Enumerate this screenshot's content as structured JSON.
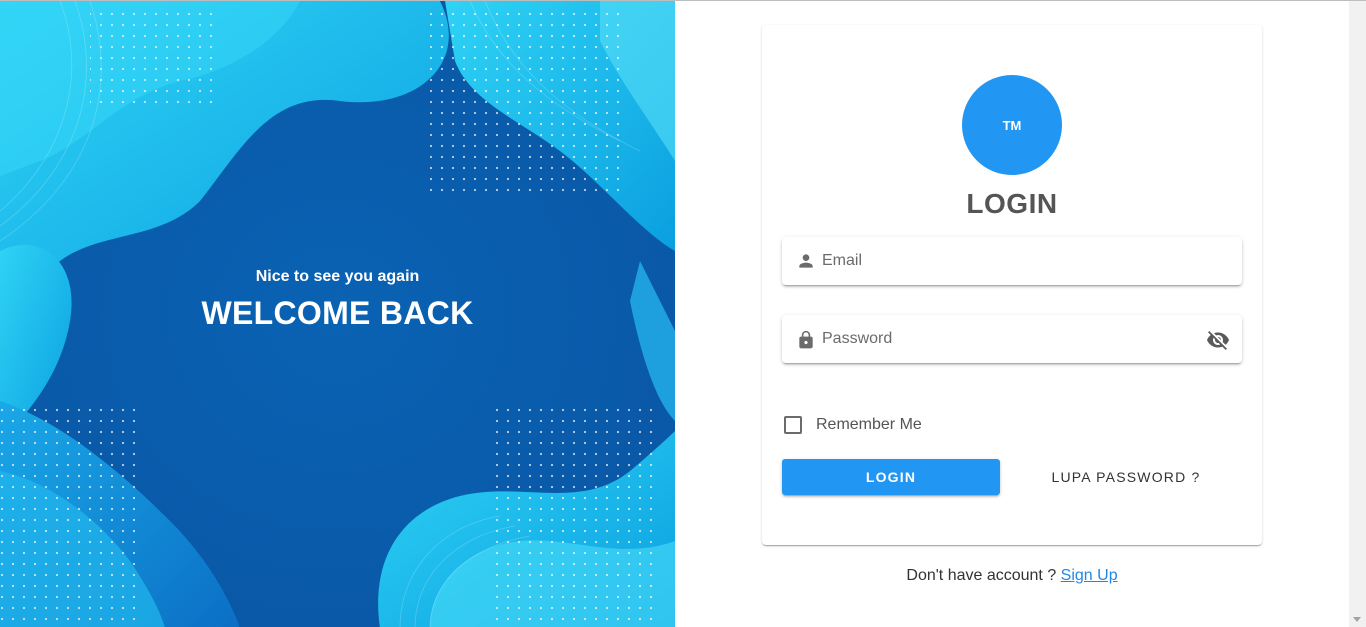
{
  "hero": {
    "subtitle": "Nice to see you again",
    "title": "WELCOME BACK"
  },
  "card": {
    "avatar_text": "TM",
    "title": "LOGIN",
    "email": {
      "placeholder": "Email",
      "value": "",
      "icon": "person-icon"
    },
    "password": {
      "placeholder": "Password",
      "value": "",
      "icon": "lock-icon",
      "toggle_icon": "eye-off-icon"
    },
    "remember_label": "Remember Me",
    "remember_checked": false,
    "login_label": "LOGIN",
    "forgot_label": "LUPA PASSWORD ?"
  },
  "footer": {
    "prompt": "Don't have account ?",
    "signup_label": "Sign Up"
  },
  "colors": {
    "accent": "#2196f3",
    "hero_dark": "#0b63b5",
    "hero_light": "#18c3f0"
  }
}
